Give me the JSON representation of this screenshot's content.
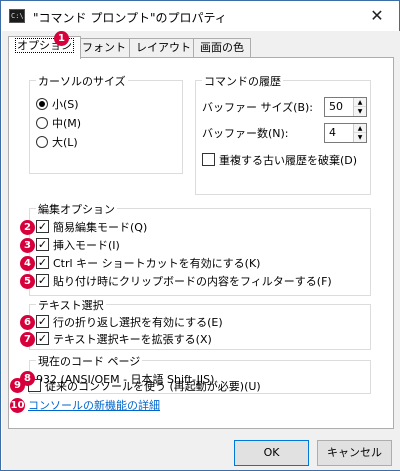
{
  "window": {
    "title": "\"コマンド プロンプト\"のプロパティ",
    "icon_text": "C:\\",
    "close_glyph": "✕"
  },
  "tabs": [
    {
      "label": "オプション",
      "active": true
    },
    {
      "label": "フォント",
      "active": false
    },
    {
      "label": "レイアウト",
      "active": false
    },
    {
      "label": "画面の色",
      "active": false
    }
  ],
  "cursor_size": {
    "title": "カーソルのサイズ",
    "options": [
      {
        "label": "小(S)",
        "selected": true
      },
      {
        "label": "中(M)",
        "selected": false
      },
      {
        "label": "大(L)",
        "selected": false
      }
    ]
  },
  "history": {
    "title": "コマンドの履歴",
    "buffer_size_label": "バッファー サイズ(B):",
    "buffer_size_value": "50",
    "buffer_count_label": "バッファー数(N):",
    "buffer_count_value": "4",
    "discard_dup_label": "重複する古い履歴を破棄(D)",
    "discard_dup_checked": false
  },
  "edit_options": {
    "title": "編集オプション",
    "items": [
      {
        "label": "簡易編集モード(Q)",
        "checked": true
      },
      {
        "label": "挿入モード(I)",
        "checked": true
      },
      {
        "label": "Ctrl キー ショートカットを有効にする(K)",
        "checked": true
      },
      {
        "label": "貼り付け時にクリップボードの内容をフィルターする(F)",
        "checked": true
      }
    ]
  },
  "text_selection": {
    "title": "テキスト選択",
    "items": [
      {
        "label": "行の折り返し選択を有効にする(E)",
        "checked": true
      },
      {
        "label": "テキスト選択キーを拡張する(X)",
        "checked": true
      }
    ]
  },
  "codepage": {
    "title": "現在のコード ページ",
    "value": "932   (ANSI/OEM - 日本語 Shift-JIS)"
  },
  "legacy": {
    "label": "従来のコンソールを使う (再起動が必要)(U)",
    "checked": false
  },
  "link": {
    "label": "コンソールの新機能の詳細"
  },
  "badges": [
    "1",
    "2",
    "3",
    "4",
    "5",
    "6",
    "7",
    "8",
    "9",
    "10"
  ],
  "buttons": {
    "ok": "OK",
    "cancel": "キャンセル"
  },
  "colors": {
    "badge": "#d7003a",
    "link": "#0066cc",
    "accent": "#0078d7"
  }
}
